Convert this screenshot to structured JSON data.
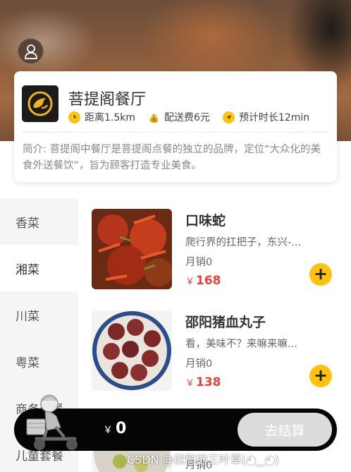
{
  "header": {
    "background": "food-photo",
    "profile_icon": "user-icon"
  },
  "shop": {
    "name": "菩提阁餐厅",
    "logo_icon": "shrimp-logo-icon",
    "distance": "距离1.5km",
    "delivery_fee": "配送费6元",
    "eta": "预计时长12min",
    "intro": "简介: 菩提阁中餐厅是菩提阁点餐的独立的品牌，定位“大众化的美食外送餐饮”，旨为顾客打造专业美食。"
  },
  "categories": [
    {
      "label": "香菜",
      "active": false
    },
    {
      "label": "湘菜",
      "active": true
    },
    {
      "label": "川菜",
      "active": false
    },
    {
      "label": "粤菜",
      "active": false
    },
    {
      "label": "商务套餐",
      "active": false
    },
    {
      "label": "儿童套餐",
      "active": false
    }
  ],
  "dishes": [
    {
      "name": "口味蛇",
      "desc": "爬行界的扛把子，东兴-...",
      "sales": "月销0",
      "currency": "￥",
      "price": "168"
    },
    {
      "name": "邵阳猪血丸子",
      "desc": "看，美味不？来嘛来嘛...",
      "sales": "月销0",
      "currency": "￥",
      "price": "138"
    },
    {
      "sales": "月销0"
    }
  ],
  "cart": {
    "currency": "￥",
    "total": "0",
    "checkout_label": "去结算"
  },
  "watermark": "CSDN @欣慰的三叶草(◕‿◕)",
  "colors": {
    "accent": "#ffc20e",
    "price": "#e8433a",
    "cart_bar": "#050505",
    "checkout_disabled": "#dcdcdc"
  }
}
